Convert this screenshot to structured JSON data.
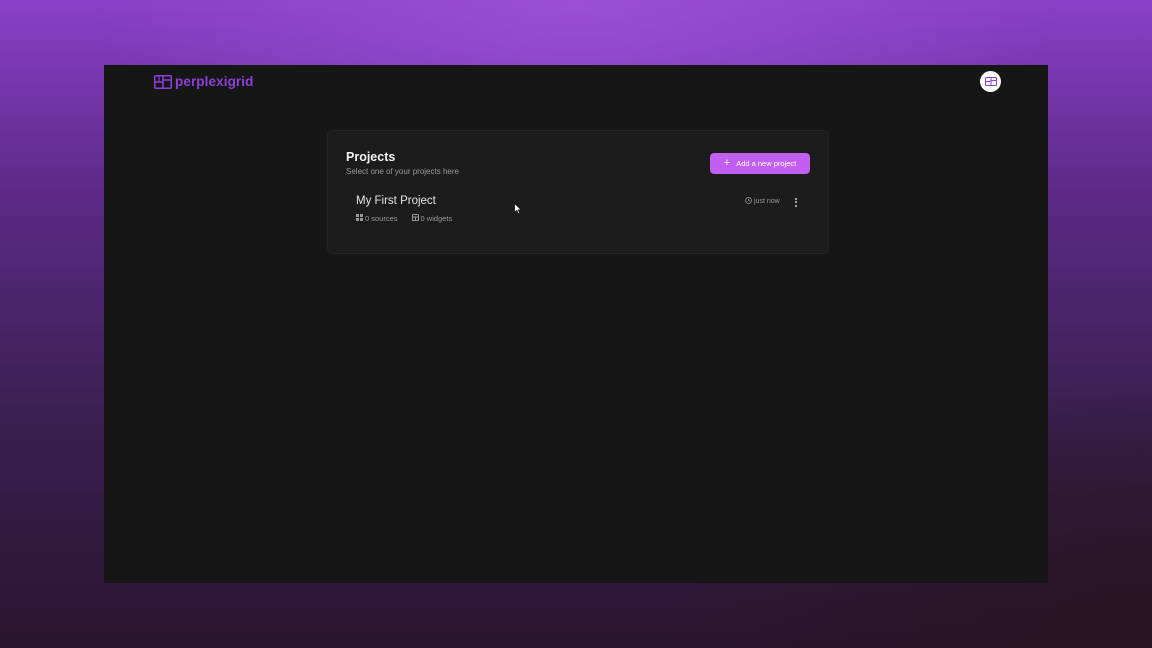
{
  "brand": {
    "name": "perplexigrid",
    "color": "#8e3fd8"
  },
  "projects_card": {
    "title": "Projects",
    "subtitle": "Select one of your projects here",
    "add_button_label": "Add a new project",
    "add_button_color": "#c05ff0"
  },
  "projects": [
    {
      "name": "My First Project",
      "sources": "0 sources",
      "widgets": "0 widgets",
      "updated": "just now"
    }
  ],
  "icons": {
    "logo": "grid-logo-icon",
    "avatar": "user-grid-icon",
    "add": "plus-icon",
    "sources": "grid-icon",
    "widgets": "widget-icon",
    "time": "clock-icon",
    "menu": "more-vertical-icon"
  }
}
